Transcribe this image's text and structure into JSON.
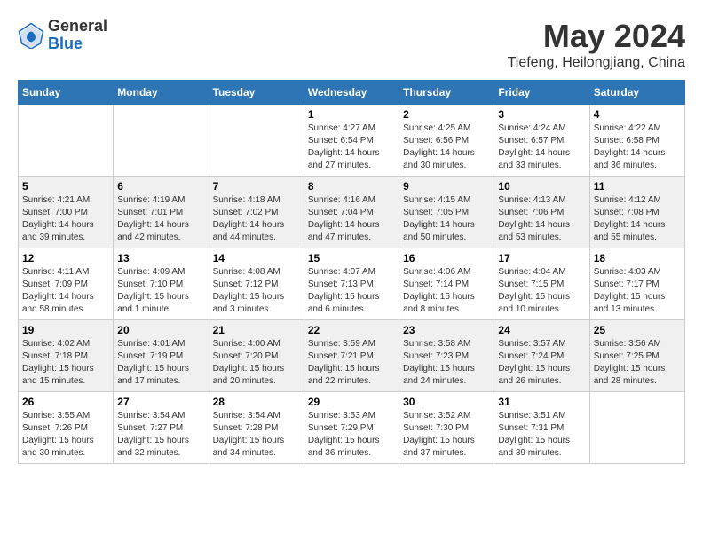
{
  "logo": {
    "text_general": "General",
    "text_blue": "Blue"
  },
  "header": {
    "title": "May 2024",
    "subtitle": "Tiefeng, Heilongjiang, China"
  },
  "weekdays": [
    "Sunday",
    "Monday",
    "Tuesday",
    "Wednesday",
    "Thursday",
    "Friday",
    "Saturday"
  ],
  "weeks": [
    [
      {
        "day": "",
        "info": ""
      },
      {
        "day": "",
        "info": ""
      },
      {
        "day": "",
        "info": ""
      },
      {
        "day": "1",
        "info": "Sunrise: 4:27 AM\nSunset: 6:54 PM\nDaylight: 14 hours\nand 27 minutes."
      },
      {
        "day": "2",
        "info": "Sunrise: 4:25 AM\nSunset: 6:56 PM\nDaylight: 14 hours\nand 30 minutes."
      },
      {
        "day": "3",
        "info": "Sunrise: 4:24 AM\nSunset: 6:57 PM\nDaylight: 14 hours\nand 33 minutes."
      },
      {
        "day": "4",
        "info": "Sunrise: 4:22 AM\nSunset: 6:58 PM\nDaylight: 14 hours\nand 36 minutes."
      }
    ],
    [
      {
        "day": "5",
        "info": "Sunrise: 4:21 AM\nSunset: 7:00 PM\nDaylight: 14 hours\nand 39 minutes."
      },
      {
        "day": "6",
        "info": "Sunrise: 4:19 AM\nSunset: 7:01 PM\nDaylight: 14 hours\nand 42 minutes."
      },
      {
        "day": "7",
        "info": "Sunrise: 4:18 AM\nSunset: 7:02 PM\nDaylight: 14 hours\nand 44 minutes."
      },
      {
        "day": "8",
        "info": "Sunrise: 4:16 AM\nSunset: 7:04 PM\nDaylight: 14 hours\nand 47 minutes."
      },
      {
        "day": "9",
        "info": "Sunrise: 4:15 AM\nSunset: 7:05 PM\nDaylight: 14 hours\nand 50 minutes."
      },
      {
        "day": "10",
        "info": "Sunrise: 4:13 AM\nSunset: 7:06 PM\nDaylight: 14 hours\nand 53 minutes."
      },
      {
        "day": "11",
        "info": "Sunrise: 4:12 AM\nSunset: 7:08 PM\nDaylight: 14 hours\nand 55 minutes."
      }
    ],
    [
      {
        "day": "12",
        "info": "Sunrise: 4:11 AM\nSunset: 7:09 PM\nDaylight: 14 hours\nand 58 minutes."
      },
      {
        "day": "13",
        "info": "Sunrise: 4:09 AM\nSunset: 7:10 PM\nDaylight: 15 hours\nand 1 minute."
      },
      {
        "day": "14",
        "info": "Sunrise: 4:08 AM\nSunset: 7:12 PM\nDaylight: 15 hours\nand 3 minutes."
      },
      {
        "day": "15",
        "info": "Sunrise: 4:07 AM\nSunset: 7:13 PM\nDaylight: 15 hours\nand 6 minutes."
      },
      {
        "day": "16",
        "info": "Sunrise: 4:06 AM\nSunset: 7:14 PM\nDaylight: 15 hours\nand 8 minutes."
      },
      {
        "day": "17",
        "info": "Sunrise: 4:04 AM\nSunset: 7:15 PM\nDaylight: 15 hours\nand 10 minutes."
      },
      {
        "day": "18",
        "info": "Sunrise: 4:03 AM\nSunset: 7:17 PM\nDaylight: 15 hours\nand 13 minutes."
      }
    ],
    [
      {
        "day": "19",
        "info": "Sunrise: 4:02 AM\nSunset: 7:18 PM\nDaylight: 15 hours\nand 15 minutes."
      },
      {
        "day": "20",
        "info": "Sunrise: 4:01 AM\nSunset: 7:19 PM\nDaylight: 15 hours\nand 17 minutes."
      },
      {
        "day": "21",
        "info": "Sunrise: 4:00 AM\nSunset: 7:20 PM\nDaylight: 15 hours\nand 20 minutes."
      },
      {
        "day": "22",
        "info": "Sunrise: 3:59 AM\nSunset: 7:21 PM\nDaylight: 15 hours\nand 22 minutes."
      },
      {
        "day": "23",
        "info": "Sunrise: 3:58 AM\nSunset: 7:23 PM\nDaylight: 15 hours\nand 24 minutes."
      },
      {
        "day": "24",
        "info": "Sunrise: 3:57 AM\nSunset: 7:24 PM\nDaylight: 15 hours\nand 26 minutes."
      },
      {
        "day": "25",
        "info": "Sunrise: 3:56 AM\nSunset: 7:25 PM\nDaylight: 15 hours\nand 28 minutes."
      }
    ],
    [
      {
        "day": "26",
        "info": "Sunrise: 3:55 AM\nSunset: 7:26 PM\nDaylight: 15 hours\nand 30 minutes."
      },
      {
        "day": "27",
        "info": "Sunrise: 3:54 AM\nSunset: 7:27 PM\nDaylight: 15 hours\nand 32 minutes."
      },
      {
        "day": "28",
        "info": "Sunrise: 3:54 AM\nSunset: 7:28 PM\nDaylight: 15 hours\nand 34 minutes."
      },
      {
        "day": "29",
        "info": "Sunrise: 3:53 AM\nSunset: 7:29 PM\nDaylight: 15 hours\nand 36 minutes."
      },
      {
        "day": "30",
        "info": "Sunrise: 3:52 AM\nSunset: 7:30 PM\nDaylight: 15 hours\nand 37 minutes."
      },
      {
        "day": "31",
        "info": "Sunrise: 3:51 AM\nSunset: 7:31 PM\nDaylight: 15 hours\nand 39 minutes."
      },
      {
        "day": "",
        "info": ""
      }
    ]
  ]
}
